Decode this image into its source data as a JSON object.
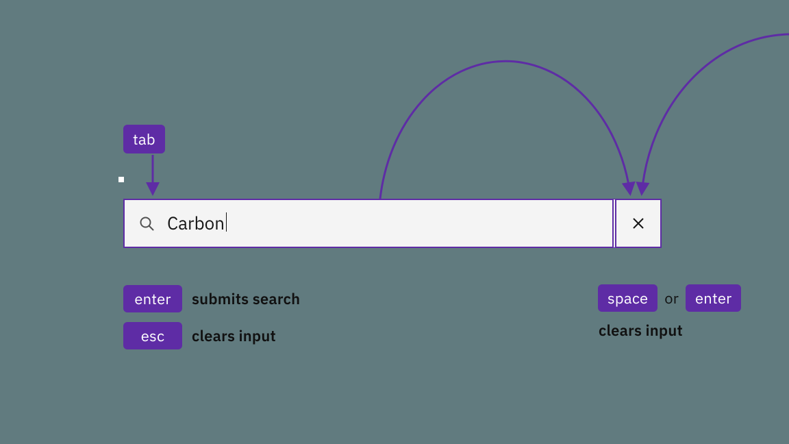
{
  "keys": {
    "tab": "tab",
    "enter": "enter",
    "esc": "esc",
    "space": "space",
    "or": "or"
  },
  "blurbs": {
    "submits_search": "submits search",
    "clears_input": "clears input"
  },
  "search": {
    "value": "Carbon"
  },
  "colors": {
    "accent": "#5e2ca5",
    "field_bg": "#f4f4f4",
    "page_bg": "#617b7f"
  }
}
